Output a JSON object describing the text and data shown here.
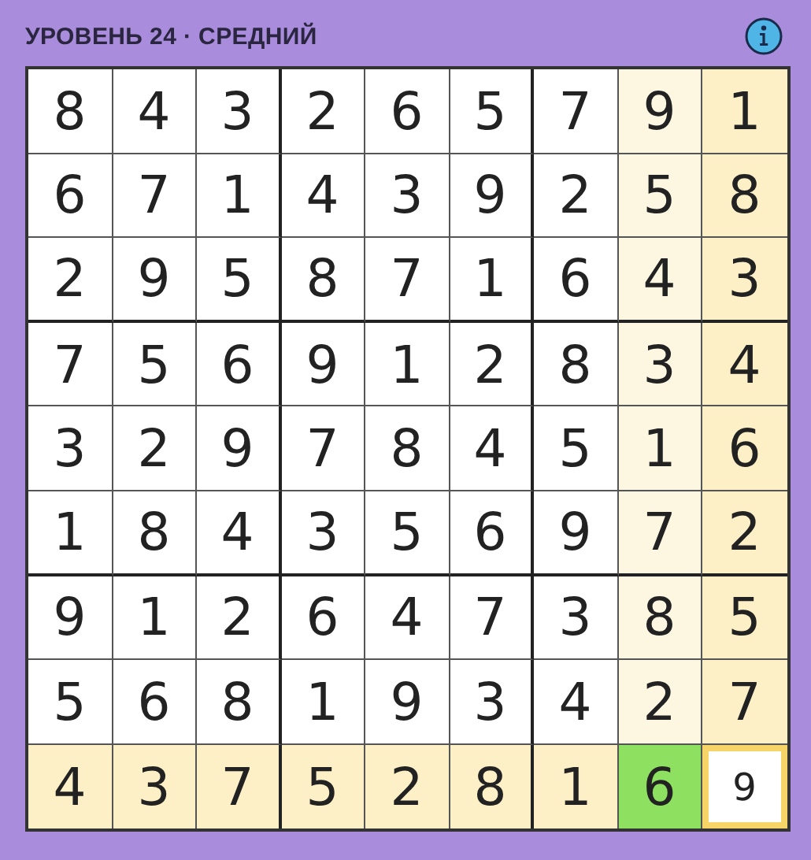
{
  "header": {
    "title": "УРОВЕНЬ 24 · СРЕДНИЙ"
  },
  "grid": [
    [
      {
        "digit": "8",
        "kind": "plain"
      },
      {
        "digit": "4",
        "kind": "plain"
      },
      {
        "digit": "3",
        "kind": "plain"
      },
      {
        "digit": "2",
        "kind": "plain"
      },
      {
        "digit": "6",
        "kind": "plain"
      },
      {
        "digit": "5",
        "kind": "plain"
      },
      {
        "digit": "7",
        "kind": "plain"
      },
      {
        "digit": "9",
        "kind": "light"
      },
      {
        "digit": "1",
        "kind": "related"
      }
    ],
    [
      {
        "digit": "6",
        "kind": "plain"
      },
      {
        "digit": "7",
        "kind": "plain"
      },
      {
        "digit": "1",
        "kind": "plain"
      },
      {
        "digit": "4",
        "kind": "plain"
      },
      {
        "digit": "3",
        "kind": "plain"
      },
      {
        "digit": "9",
        "kind": "plain"
      },
      {
        "digit": "2",
        "kind": "plain"
      },
      {
        "digit": "5",
        "kind": "light"
      },
      {
        "digit": "8",
        "kind": "related"
      }
    ],
    [
      {
        "digit": "2",
        "kind": "plain"
      },
      {
        "digit": "9",
        "kind": "plain"
      },
      {
        "digit": "5",
        "kind": "plain"
      },
      {
        "digit": "8",
        "kind": "plain"
      },
      {
        "digit": "7",
        "kind": "plain"
      },
      {
        "digit": "1",
        "kind": "plain"
      },
      {
        "digit": "6",
        "kind": "plain"
      },
      {
        "digit": "4",
        "kind": "light"
      },
      {
        "digit": "3",
        "kind": "related"
      }
    ],
    [
      {
        "digit": "7",
        "kind": "plain"
      },
      {
        "digit": "5",
        "kind": "plain"
      },
      {
        "digit": "6",
        "kind": "plain"
      },
      {
        "digit": "9",
        "kind": "plain"
      },
      {
        "digit": "1",
        "kind": "plain"
      },
      {
        "digit": "2",
        "kind": "plain"
      },
      {
        "digit": "8",
        "kind": "plain"
      },
      {
        "digit": "3",
        "kind": "light"
      },
      {
        "digit": "4",
        "kind": "related"
      }
    ],
    [
      {
        "digit": "3",
        "kind": "plain"
      },
      {
        "digit": "2",
        "kind": "plain"
      },
      {
        "digit": "9",
        "kind": "plain"
      },
      {
        "digit": "7",
        "kind": "plain"
      },
      {
        "digit": "8",
        "kind": "plain"
      },
      {
        "digit": "4",
        "kind": "plain"
      },
      {
        "digit": "5",
        "kind": "plain"
      },
      {
        "digit": "1",
        "kind": "light"
      },
      {
        "digit": "6",
        "kind": "related"
      }
    ],
    [
      {
        "digit": "1",
        "kind": "plain"
      },
      {
        "digit": "8",
        "kind": "plain"
      },
      {
        "digit": "4",
        "kind": "plain"
      },
      {
        "digit": "3",
        "kind": "plain"
      },
      {
        "digit": "5",
        "kind": "plain"
      },
      {
        "digit": "6",
        "kind": "plain"
      },
      {
        "digit": "9",
        "kind": "plain"
      },
      {
        "digit": "7",
        "kind": "light"
      },
      {
        "digit": "2",
        "kind": "related"
      }
    ],
    [
      {
        "digit": "9",
        "kind": "plain"
      },
      {
        "digit": "1",
        "kind": "plain"
      },
      {
        "digit": "2",
        "kind": "plain"
      },
      {
        "digit": "6",
        "kind": "plain"
      },
      {
        "digit": "4",
        "kind": "plain"
      },
      {
        "digit": "7",
        "kind": "plain"
      },
      {
        "digit": "3",
        "kind": "plain"
      },
      {
        "digit": "8",
        "kind": "light"
      },
      {
        "digit": "5",
        "kind": "related"
      }
    ],
    [
      {
        "digit": "5",
        "kind": "plain"
      },
      {
        "digit": "6",
        "kind": "plain"
      },
      {
        "digit": "8",
        "kind": "plain"
      },
      {
        "digit": "1",
        "kind": "plain"
      },
      {
        "digit": "9",
        "kind": "plain"
      },
      {
        "digit": "3",
        "kind": "plain"
      },
      {
        "digit": "4",
        "kind": "plain"
      },
      {
        "digit": "2",
        "kind": "light"
      },
      {
        "digit": "7",
        "kind": "related"
      }
    ],
    [
      {
        "digit": "4",
        "kind": "related"
      },
      {
        "digit": "3",
        "kind": "related"
      },
      {
        "digit": "7",
        "kind": "related"
      },
      {
        "digit": "5",
        "kind": "related"
      },
      {
        "digit": "2",
        "kind": "related"
      },
      {
        "digit": "8",
        "kind": "related"
      },
      {
        "digit": "1",
        "kind": "related"
      },
      {
        "digit": "6",
        "kind": "correct"
      },
      {
        "digit": "9",
        "kind": "selected"
      }
    ]
  ]
}
